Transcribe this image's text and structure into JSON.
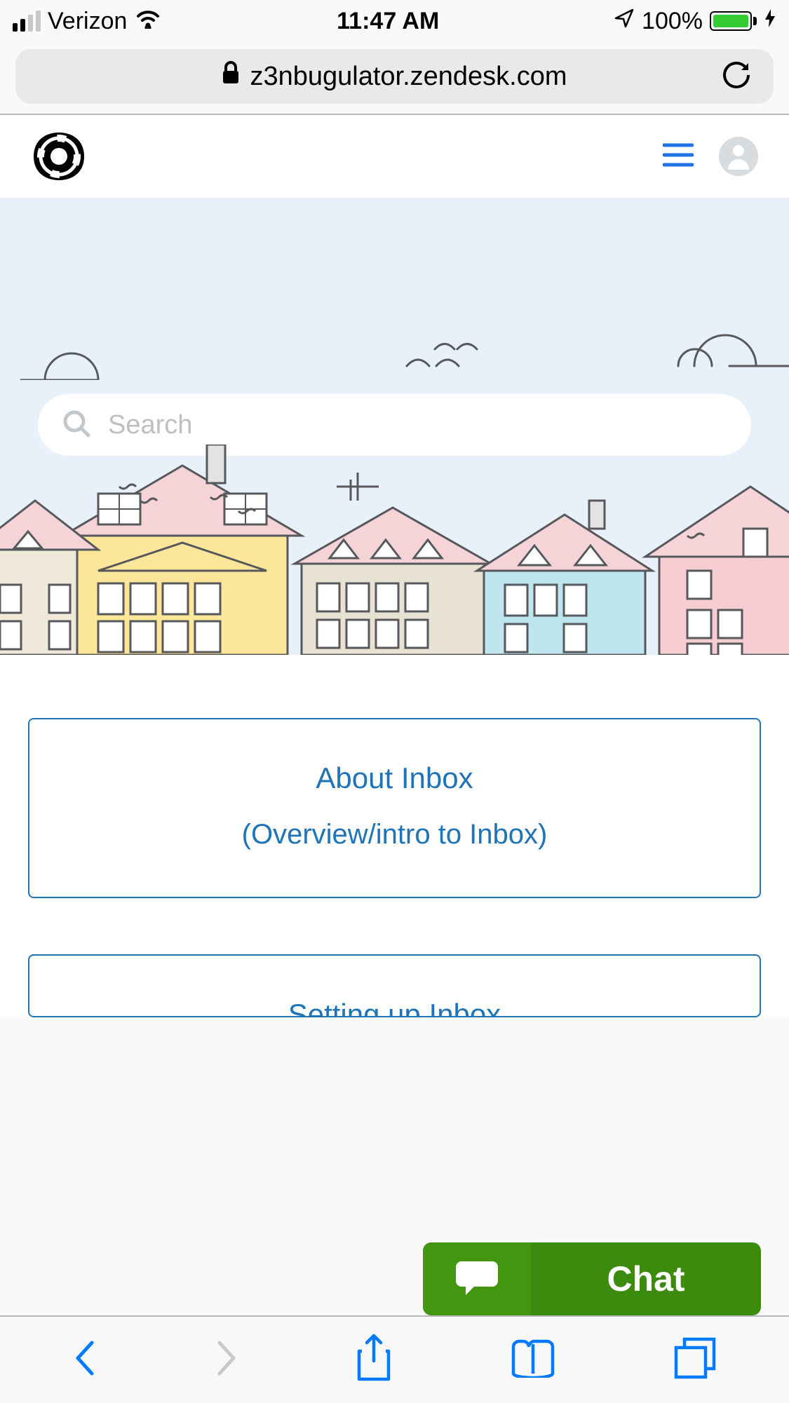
{
  "status": {
    "carrier": "Verizon",
    "time": "11:47 AM",
    "battery": "100%"
  },
  "url": "z3nbugulator.zendesk.com",
  "search": {
    "placeholder": "Search"
  },
  "cards": {
    "card1_title": "About Inbox",
    "card1_sub": "(Overview/intro to Inbox)",
    "card2_title": "Setting up Inbox"
  },
  "chat": {
    "label": "Chat"
  }
}
